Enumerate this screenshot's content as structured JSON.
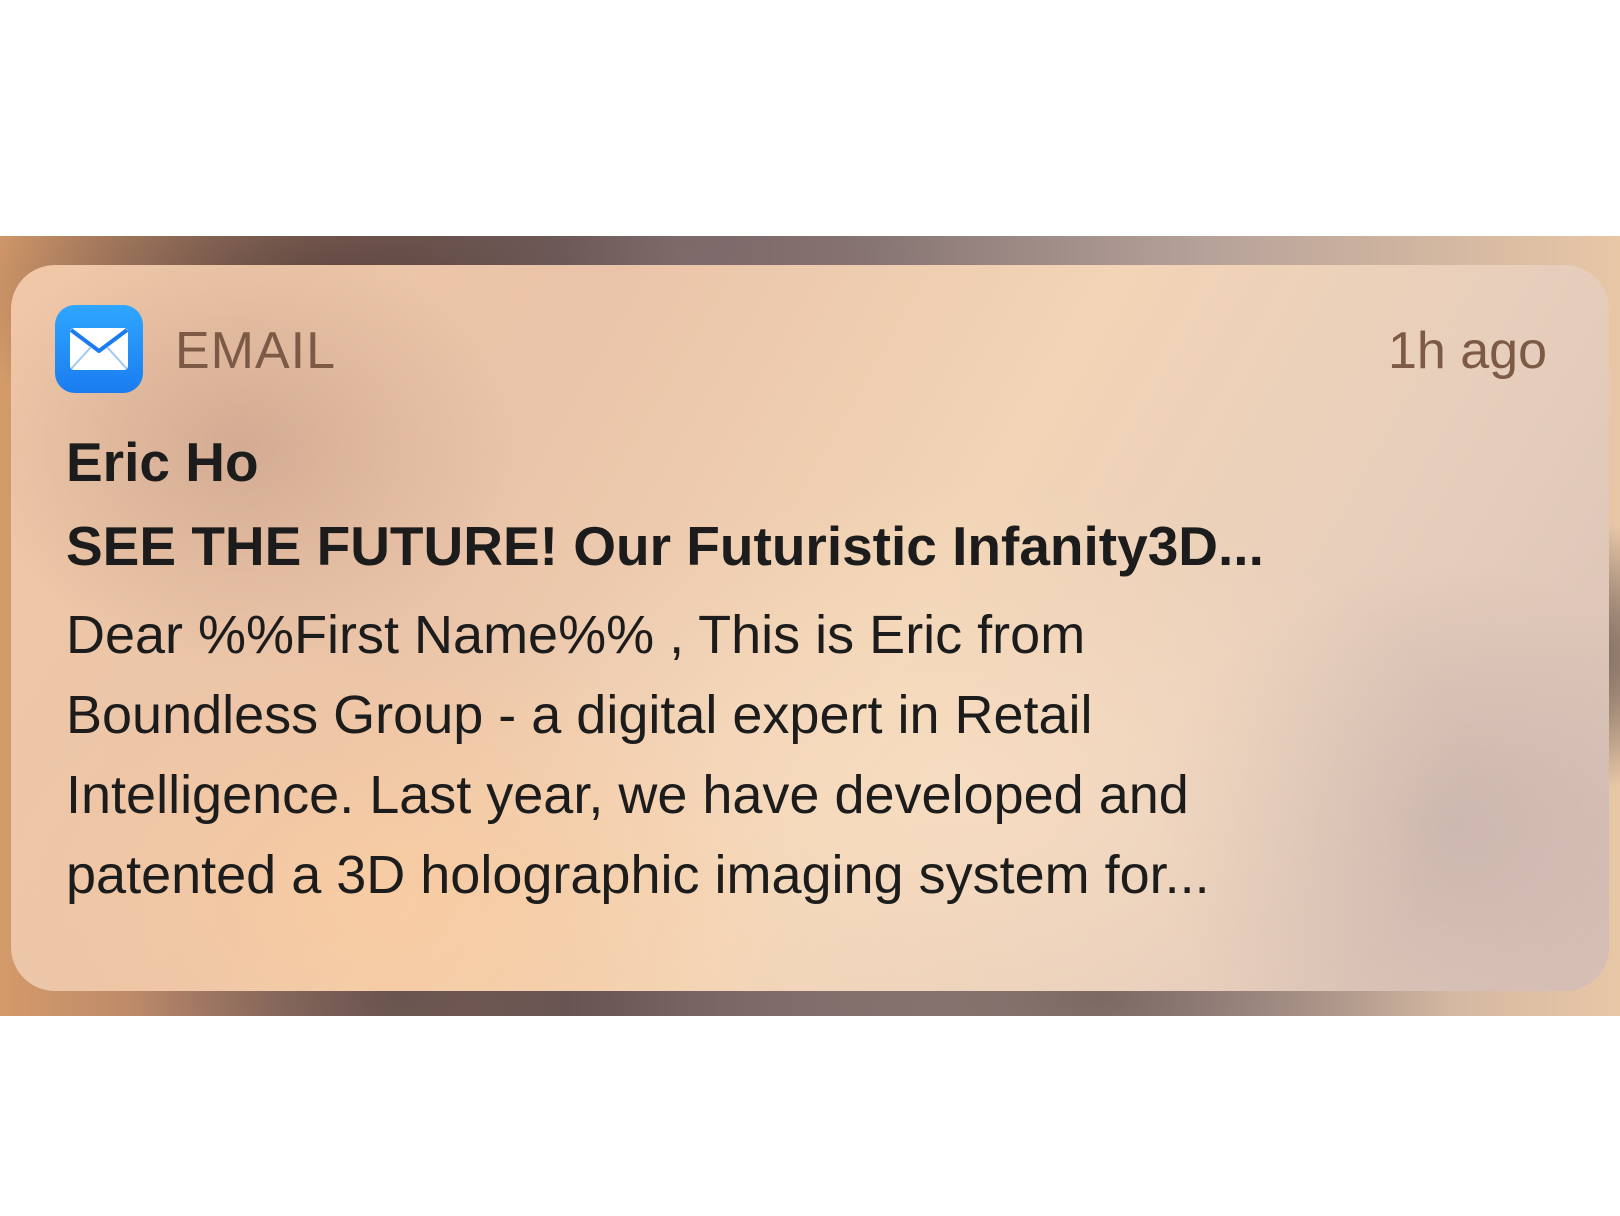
{
  "notification": {
    "app_name": "EMAIL",
    "time": "1h ago",
    "icon": "mail-envelope-icon",
    "sender": "Eric Ho",
    "subject": "SEE THE FUTURE! Our Futuristic Infanity3D...",
    "body_lines": [
      "Dear %%First Name%% , This is Eric from",
      "Boundless Group - a digital expert in Retail",
      "Intelligence. Last year, we have developed and",
      "patented a 3D holographic imaging system for..."
    ]
  },
  "colors": {
    "icon_blue": "#1a7cf0",
    "header_text": "#7c5a45",
    "body_text": "#1c1c1c"
  }
}
